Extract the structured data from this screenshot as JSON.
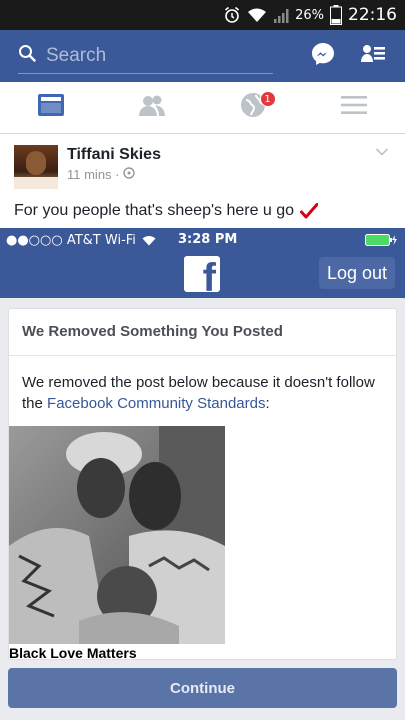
{
  "status_bar": {
    "battery_percent": "26%",
    "time": "22:16",
    "icons": [
      "alarm-icon",
      "wifi-icon",
      "signal-icon",
      "battery-icon"
    ]
  },
  "header": {
    "search_placeholder": "Search",
    "icons": [
      "search-icon",
      "messenger-icon",
      "friends-list-icon"
    ]
  },
  "tabs": [
    {
      "name": "news-feed",
      "icon": "news-feed-icon",
      "active": true
    },
    {
      "name": "friends",
      "icon": "friends-icon",
      "active": false
    },
    {
      "name": "notifications",
      "icon": "globe-icon",
      "badge": "1",
      "active": false
    },
    {
      "name": "menu",
      "icon": "menu-icon",
      "active": false
    }
  ],
  "post": {
    "author": "Tiffani Skies",
    "time": "11 mins",
    "privacy_icon": "public-icon",
    "text": "For you people that's sheep's here u go"
  },
  "screenshot": {
    "ios_status": {
      "carrier": "●●○○○ AT&T Wi-Fi",
      "time": "3:28 PM"
    },
    "logo_letter": "f",
    "logout_label": "Log out",
    "card": {
      "title": "We Removed Something You Posted",
      "body_prefix": "We removed the post below because it doesn't follow the ",
      "body_link": "Facebook Community Standards",
      "body_suffix": ":",
      "photo_caption": "Black Love Matters"
    },
    "continue_label": "Continue"
  },
  "colors": {
    "facebook_blue": "#3b5998",
    "badge_red": "#e0393e",
    "battery_green": "#4cd964",
    "checkmark_red": "#d0021b"
  }
}
